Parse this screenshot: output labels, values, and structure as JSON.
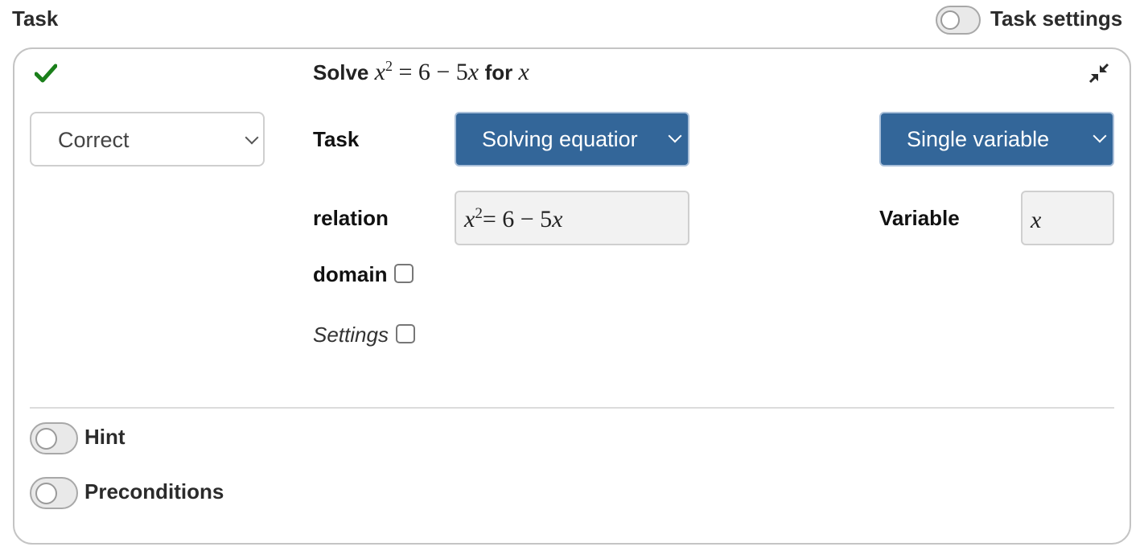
{
  "header": {
    "title": "Task",
    "task_settings_toggle": {
      "label": "Task settings",
      "on": false
    }
  },
  "card": {
    "status_icon": "checkmark-icon",
    "status_color": "#1a7f1a",
    "collapse_icon": "compress-arrows-icon",
    "title": {
      "prefix": "Solve",
      "equation": {
        "lhs_var": "x",
        "exponent": "2",
        "rhs": "= 6 − 5",
        "rhs_var": "x"
      },
      "middle": "for",
      "variable": "x"
    },
    "grade_select": {
      "value": "Correct"
    },
    "task_row": {
      "label": "Task",
      "task_type_select": {
        "value": "Solving equation",
        "display": "Solving equatior"
      },
      "variable_mode_select": {
        "value": "Single variable"
      }
    },
    "relation_row": {
      "label": "relation",
      "value": {
        "lhs_var": "x",
        "exponent": "2",
        "rhs": "= 6 − 5",
        "rhs_var": "x"
      }
    },
    "variable_row": {
      "label": "Variable",
      "value": "x"
    },
    "domain": {
      "label": "domain",
      "checked": false
    },
    "settings": {
      "label": "Settings",
      "checked": false
    },
    "hint_toggle": {
      "label": "Hint",
      "on": false
    },
    "preconditions_toggle": {
      "label": "Preconditions",
      "on": false
    }
  },
  "colors": {
    "accent_blue": "#336699",
    "success_green": "#1a7f1a"
  }
}
